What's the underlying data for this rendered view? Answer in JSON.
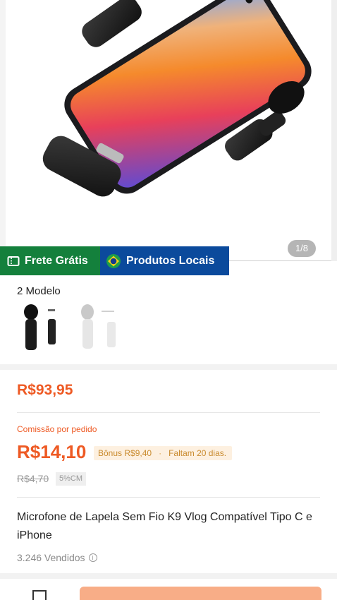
{
  "gallery": {
    "pager": "1/8"
  },
  "badges": {
    "frete": "Frete Grátis",
    "locais": "Produtos Locais"
  },
  "variants": {
    "title": "2 Modelo"
  },
  "price": {
    "main": "R$93,95",
    "commission_label": "Comissão por pedido",
    "commission_value": "R$14,10",
    "bonus": "Bônus R$9,40",
    "deadline": "Faltam 20 dias.",
    "old_price": "R$4,70",
    "cm_tag": "5%CM"
  },
  "product": {
    "title": "Microfone de Lapela Sem Fio K9 Vlog Compatível Tipo C e iPhone",
    "sold": "3.246 Vendidos",
    "info_icon": "i"
  },
  "colors": {
    "accent": "#ee5a24",
    "frete_green": "#14803c",
    "locais_blue": "#0b4a9c",
    "cta": "#f8ad87"
  }
}
